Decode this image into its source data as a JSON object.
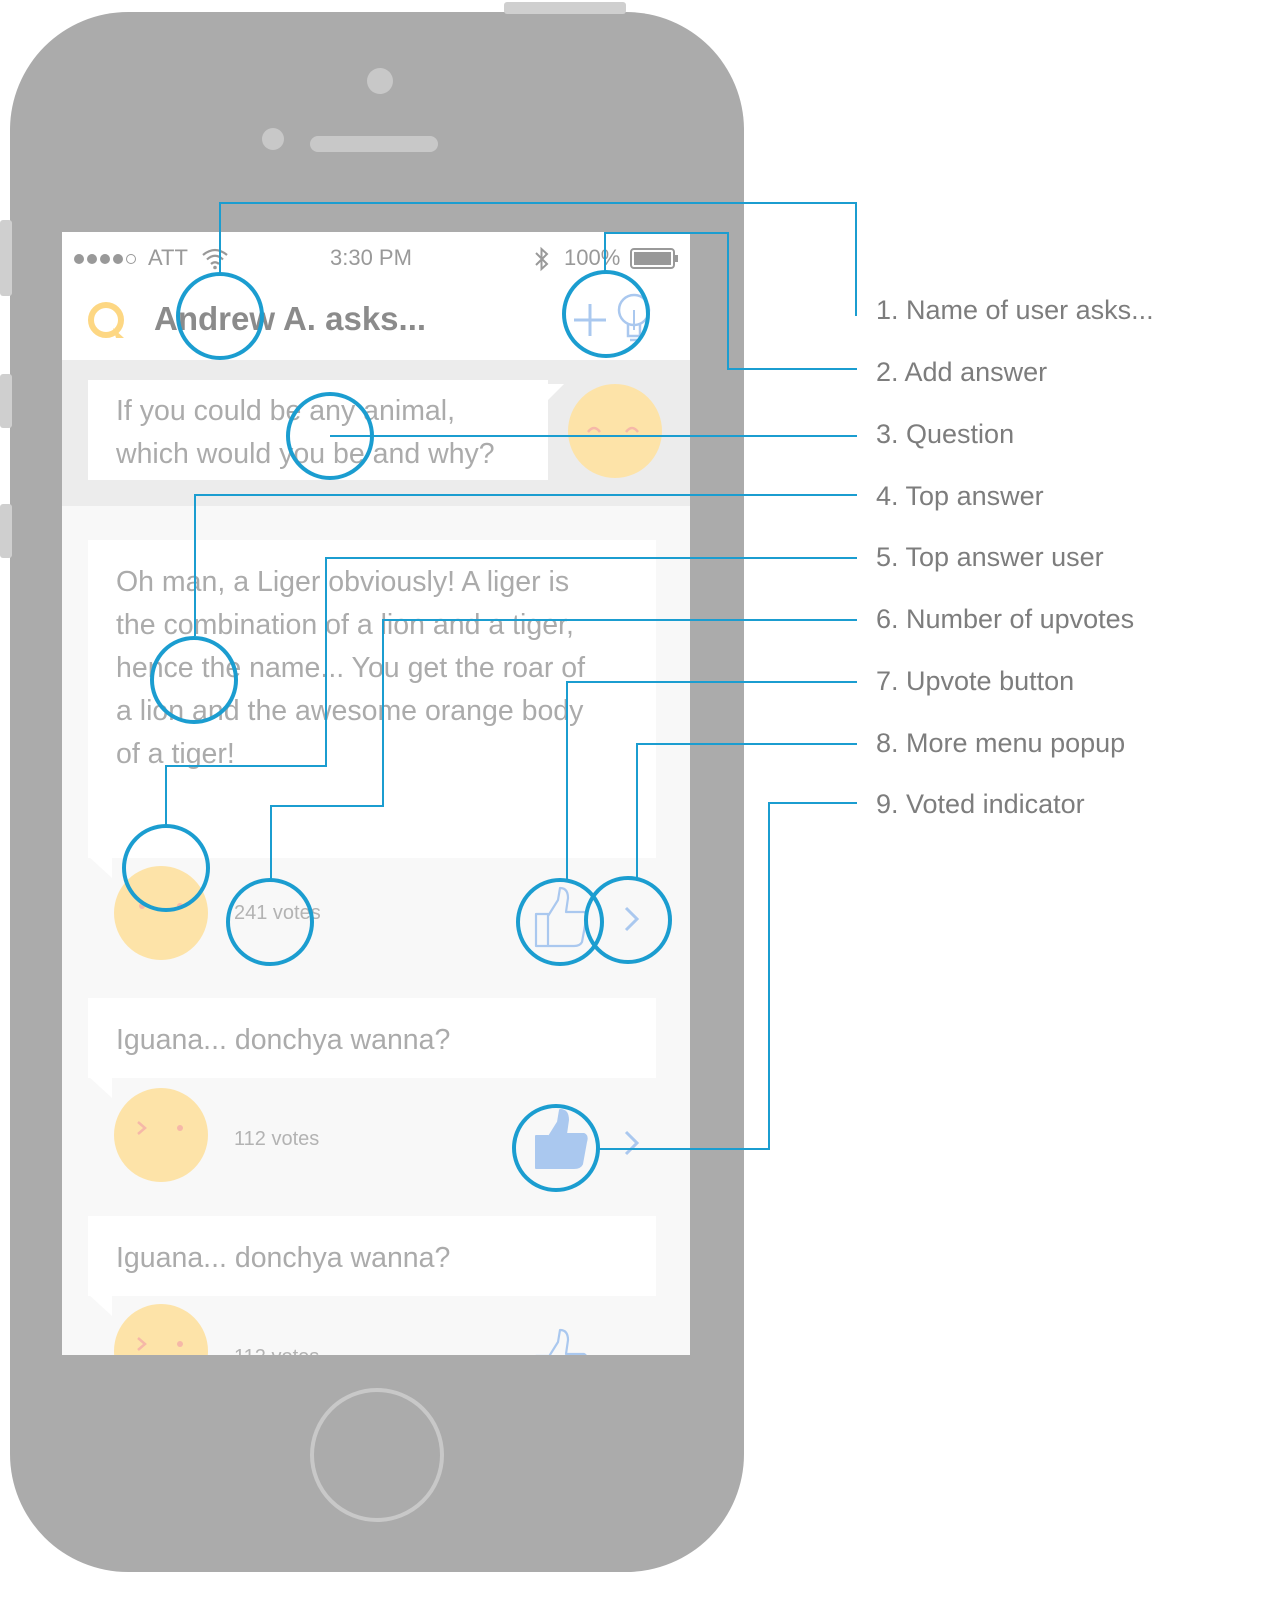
{
  "status_bar": {
    "carrier": "ATT",
    "time": "3:30 PM",
    "battery": "100%"
  },
  "nav": {
    "title": "Andrew A. asks..."
  },
  "question": {
    "line1": "If you could be any animal,",
    "line2": "which would you be and why?"
  },
  "answers": [
    {
      "lines": [
        "Oh man, a Liger obviously! A liger is",
        "the combination of a lion and a tiger,",
        "hence the name... You get the roar of",
        "a lion and the awesome orange body",
        "of a tiger!"
      ],
      "votes": "241 votes",
      "voted": false
    },
    {
      "text": "Iguana... donchya wanna?",
      "votes": "112 votes",
      "voted": true
    },
    {
      "text": "Iguana... donchya wanna?",
      "votes": "112 votes",
      "voted": false
    }
  ],
  "annotations": [
    "1. Name of user asks...",
    "2. Add answer",
    "3. Question",
    "4. Top answer",
    "5. Top answer user",
    "6. Number of upvotes",
    "7. Upvote button",
    "8. More menu popup",
    "9. Voted indicator"
  ],
  "colors": {
    "phone": "#ababab",
    "annotation": "#1b9dd0",
    "accent": "#aac8ef",
    "avatar": "#fde3a8",
    "logo": "#fdd783"
  },
  "icons": [
    "logo-icon",
    "add-icon",
    "lightbulb-icon",
    "wifi-icon",
    "bluetooth-icon",
    "battery-icon",
    "thumbs-up-icon",
    "chevron-right-icon"
  ]
}
